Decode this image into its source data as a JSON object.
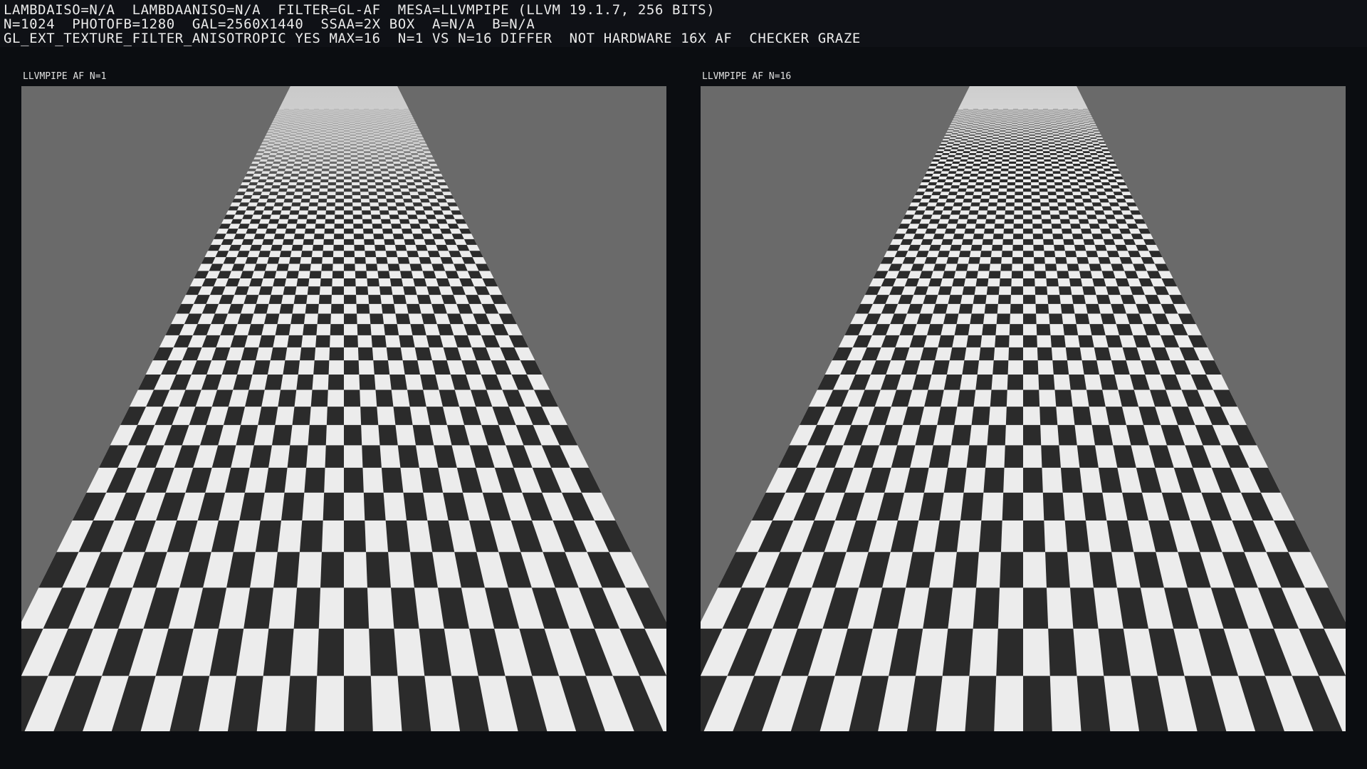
{
  "hud": {
    "line1": "LAMBDAISO=N/A  LAMBDAANISO=N/A  FILTER=GL-AF  MESA=LLVMPIPE (LLVM 19.1.7, 256 BITS)",
    "line2": "N=1024  PHOTOFB=1280  GAL=2560X1440  SSAA=2X BOX  A=N/A  B=N/A",
    "line3": "GL_EXT_TEXTURE_FILTER_ANISOTROPIC YES MAX=16  N=1 VS N=16 DIFFER  NOT HARDWARE 16X AF  CHECKER GRAZE"
  },
  "panels": [
    {
      "label": "LLVMPIPE AF N=1",
      "aniso": 1
    },
    {
      "label": "LLVMPIPE AF N=16",
      "aniso": 16
    }
  ],
  "colors": {
    "background": "#0b0d11",
    "sky": "#6a6a6a",
    "checker_light": "#ececec",
    "checker_dark": "#2b2b2b",
    "far_blend": "#c8c8c8"
  }
}
